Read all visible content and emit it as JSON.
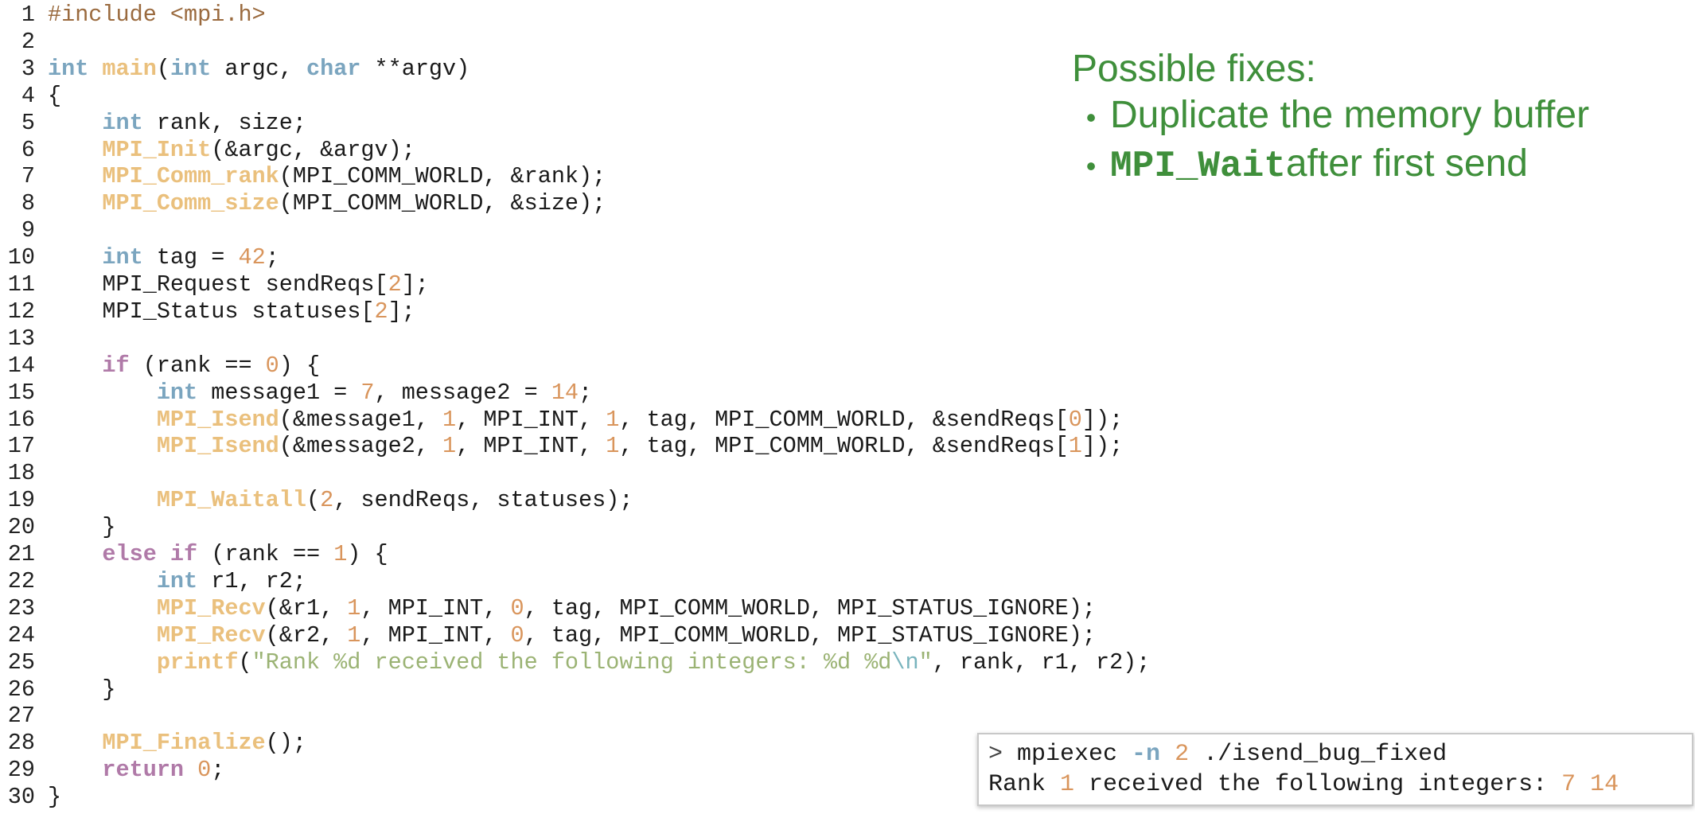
{
  "editor": {
    "lines": [
      {
        "n": "1",
        "tokens": [
          [
            "pp",
            "#include <mpi.h>"
          ]
        ]
      },
      {
        "n": "2",
        "tokens": []
      },
      {
        "n": "3",
        "tokens": [
          [
            "ty",
            "int"
          ],
          [
            "tx",
            " "
          ],
          [
            "fn",
            "main"
          ],
          [
            "tx",
            "("
          ],
          [
            "ty",
            "int"
          ],
          [
            "tx",
            " argc, "
          ],
          [
            "ty",
            "char"
          ],
          [
            "tx",
            " **argv)"
          ]
        ]
      },
      {
        "n": "4",
        "tokens": [
          [
            "tx",
            "{"
          ]
        ]
      },
      {
        "n": "5",
        "tokens": [
          [
            "tx",
            "    "
          ],
          [
            "ty",
            "int"
          ],
          [
            "tx",
            " rank, size;"
          ]
        ]
      },
      {
        "n": "6",
        "tokens": [
          [
            "tx",
            "    "
          ],
          [
            "fn",
            "MPI_Init"
          ],
          [
            "tx",
            "(&argc, &argv);"
          ]
        ]
      },
      {
        "n": "7",
        "tokens": [
          [
            "tx",
            "    "
          ],
          [
            "fn",
            "MPI_Comm_rank"
          ],
          [
            "tx",
            "(MPI_COMM_WORLD, &rank);"
          ]
        ]
      },
      {
        "n": "8",
        "tokens": [
          [
            "tx",
            "    "
          ],
          [
            "fn",
            "MPI_Comm_size"
          ],
          [
            "tx",
            "(MPI_COMM_WORLD, &size);"
          ]
        ]
      },
      {
        "n": "9",
        "tokens": []
      },
      {
        "n": "10",
        "tokens": [
          [
            "tx",
            "    "
          ],
          [
            "ty",
            "int"
          ],
          [
            "tx",
            " tag = "
          ],
          [
            "num",
            "42"
          ],
          [
            "tx",
            ";"
          ]
        ]
      },
      {
        "n": "11",
        "tokens": [
          [
            "tx",
            "    MPI_Request sendReqs["
          ],
          [
            "num",
            "2"
          ],
          [
            "tx",
            "];"
          ]
        ]
      },
      {
        "n": "12",
        "tokens": [
          [
            "tx",
            "    MPI_Status statuses["
          ],
          [
            "num",
            "2"
          ],
          [
            "tx",
            "];"
          ]
        ]
      },
      {
        "n": "13",
        "tokens": []
      },
      {
        "n": "14",
        "tokens": [
          [
            "tx",
            "    "
          ],
          [
            "kw",
            "if"
          ],
          [
            "tx",
            " (rank == "
          ],
          [
            "num",
            "0"
          ],
          [
            "tx",
            ") {"
          ]
        ]
      },
      {
        "n": "15",
        "tokens": [
          [
            "tx",
            "        "
          ],
          [
            "ty",
            "int"
          ],
          [
            "tx",
            " message1 = "
          ],
          [
            "num",
            "7"
          ],
          [
            "tx",
            ", message2 = "
          ],
          [
            "num",
            "14"
          ],
          [
            "tx",
            ";"
          ]
        ]
      },
      {
        "n": "16",
        "tokens": [
          [
            "tx",
            "        "
          ],
          [
            "fn",
            "MPI_Isend"
          ],
          [
            "tx",
            "(&message1, "
          ],
          [
            "num",
            "1"
          ],
          [
            "tx",
            ", MPI_INT, "
          ],
          [
            "num",
            "1"
          ],
          [
            "tx",
            ", tag, MPI_COMM_WORLD, &sendReqs["
          ],
          [
            "num",
            "0"
          ],
          [
            "tx",
            "]);"
          ]
        ]
      },
      {
        "n": "17",
        "tokens": [
          [
            "tx",
            "        "
          ],
          [
            "fn",
            "MPI_Isend"
          ],
          [
            "tx",
            "(&message2, "
          ],
          [
            "num",
            "1"
          ],
          [
            "tx",
            ", MPI_INT, "
          ],
          [
            "num",
            "1"
          ],
          [
            "tx",
            ", tag, MPI_COMM_WORLD, &sendReqs["
          ],
          [
            "num",
            "1"
          ],
          [
            "tx",
            "]);"
          ]
        ]
      },
      {
        "n": "18",
        "tokens": []
      },
      {
        "n": "19",
        "tokens": [
          [
            "tx",
            "        "
          ],
          [
            "fn",
            "MPI_Waitall"
          ],
          [
            "tx",
            "("
          ],
          [
            "num",
            "2"
          ],
          [
            "tx",
            ", sendReqs, statuses);"
          ]
        ]
      },
      {
        "n": "20",
        "tokens": [
          [
            "tx",
            "    }"
          ]
        ]
      },
      {
        "n": "21",
        "tokens": [
          [
            "tx",
            "    "
          ],
          [
            "kw",
            "else if"
          ],
          [
            "tx",
            " (rank == "
          ],
          [
            "num",
            "1"
          ],
          [
            "tx",
            ") {"
          ]
        ]
      },
      {
        "n": "22",
        "tokens": [
          [
            "tx",
            "        "
          ],
          [
            "ty",
            "int"
          ],
          [
            "tx",
            " r1, r2;"
          ]
        ]
      },
      {
        "n": "23",
        "tokens": [
          [
            "tx",
            "        "
          ],
          [
            "fn",
            "MPI_Recv"
          ],
          [
            "tx",
            "(&r1, "
          ],
          [
            "num",
            "1"
          ],
          [
            "tx",
            ", MPI_INT, "
          ],
          [
            "num",
            "0"
          ],
          [
            "tx",
            ", tag, MPI_COMM_WORLD, MPI_STATUS_IGNORE);"
          ]
        ]
      },
      {
        "n": "24",
        "tokens": [
          [
            "tx",
            "        "
          ],
          [
            "fn",
            "MPI_Recv"
          ],
          [
            "tx",
            "(&r2, "
          ],
          [
            "num",
            "1"
          ],
          [
            "tx",
            ", MPI_INT, "
          ],
          [
            "num",
            "0"
          ],
          [
            "tx",
            ", tag, MPI_COMM_WORLD, MPI_STATUS_IGNORE);"
          ]
        ]
      },
      {
        "n": "25",
        "tokens": [
          [
            "tx",
            "        "
          ],
          [
            "fn",
            "printf"
          ],
          [
            "tx",
            "("
          ],
          [
            "str",
            "\"Rank %d received the following integers: %d %d"
          ],
          [
            "esc",
            "\\n"
          ],
          [
            "str",
            "\""
          ],
          [
            "tx",
            ", rank, r1, r2);"
          ]
        ]
      },
      {
        "n": "26",
        "tokens": [
          [
            "tx",
            "    }"
          ]
        ]
      },
      {
        "n": "27",
        "tokens": []
      },
      {
        "n": "28",
        "tokens": [
          [
            "tx",
            "    "
          ],
          [
            "fn",
            "MPI_Finalize"
          ],
          [
            "tx",
            "();"
          ]
        ]
      },
      {
        "n": "29",
        "tokens": [
          [
            "tx",
            "    "
          ],
          [
            "kw",
            "return"
          ],
          [
            "tx",
            " "
          ],
          [
            "num",
            "0"
          ],
          [
            "tx",
            ";"
          ]
        ]
      },
      {
        "n": "30",
        "tokens": [
          [
            "tx",
            "}"
          ]
        ]
      }
    ]
  },
  "fixes": {
    "title": "Possible fixes:",
    "items": [
      {
        "code": "",
        "text": "Duplicate the memory buffer"
      },
      {
        "code": "MPI_Wait",
        "text": " after first send"
      }
    ],
    "bullet": "•"
  },
  "terminal": {
    "prompt": "> ",
    "cmd": "mpiexec ",
    "flag": "-n",
    "space1": " ",
    "np": "2",
    "target": " ./isend_bug_fixed",
    "out_prefix": "Rank ",
    "out_rank": "1",
    "out_mid": " received the following integers: ",
    "out_v1": "7",
    "out_sp": " ",
    "out_v2": "14"
  }
}
